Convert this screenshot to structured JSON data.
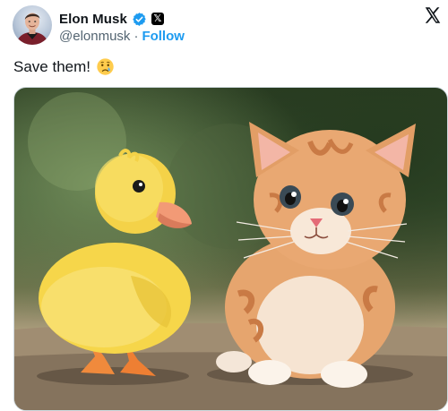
{
  "author": {
    "display_name": "Elon Musk",
    "handle": "@elonmusk",
    "separator": "·",
    "follow_label": "Follow"
  },
  "post": {
    "text": "Save them!"
  },
  "icons": {
    "verified": "verified-badge-icon",
    "affiliation": "x-affiliation-icon",
    "brand": "x-logo-icon",
    "emoji": "crying-face-emoji"
  },
  "colors": {
    "link_blue": "#1d9bf0",
    "text_primary": "#0f1419",
    "text_secondary": "#536471",
    "border": "#cfd9de"
  }
}
